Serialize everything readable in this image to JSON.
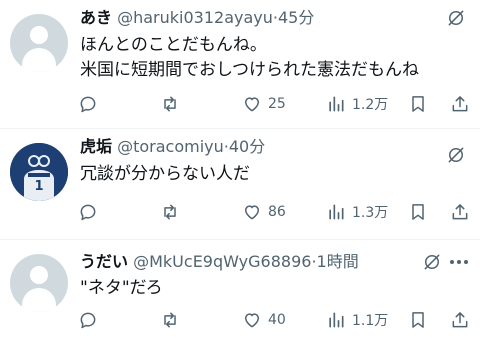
{
  "tweets": [
    {
      "name": "あき",
      "handle": "@haruki0312ayayu",
      "separator": "·",
      "time": "45分",
      "lines": [
        "ほんとのことだもんね。",
        "米国に短期間でおしつけられた憲法だもんね"
      ],
      "likes": "25",
      "views": "1.2万"
    },
    {
      "name": "虎垢",
      "handle": "@toracomiyu",
      "separator": "·",
      "time": "40分",
      "lines": [
        "冗談が分からない人だ"
      ],
      "likes": "86",
      "views": "1.3万"
    },
    {
      "name": "うだい",
      "handle": "@MkUcE9qWyG68896",
      "separator": "·",
      "time": "1時間",
      "lines": [
        "\"ネタ\"だろ"
      ],
      "likes": "40",
      "views": "1.1万"
    }
  ],
  "avatar2": {
    "jersey_number": "1"
  },
  "icons": {
    "reply": "reply-icon",
    "retweet": "retweet-icon",
    "like": "heart-icon",
    "views": "views-icon",
    "bookmark": "bookmark-icon",
    "share": "share-icon",
    "grok": "grok-icon",
    "more": "more-icon"
  },
  "colors": {
    "text": "#0f1419",
    "secondary": "#536471",
    "divider": "#eff3f4",
    "avatar_default": "#cfd9de"
  }
}
